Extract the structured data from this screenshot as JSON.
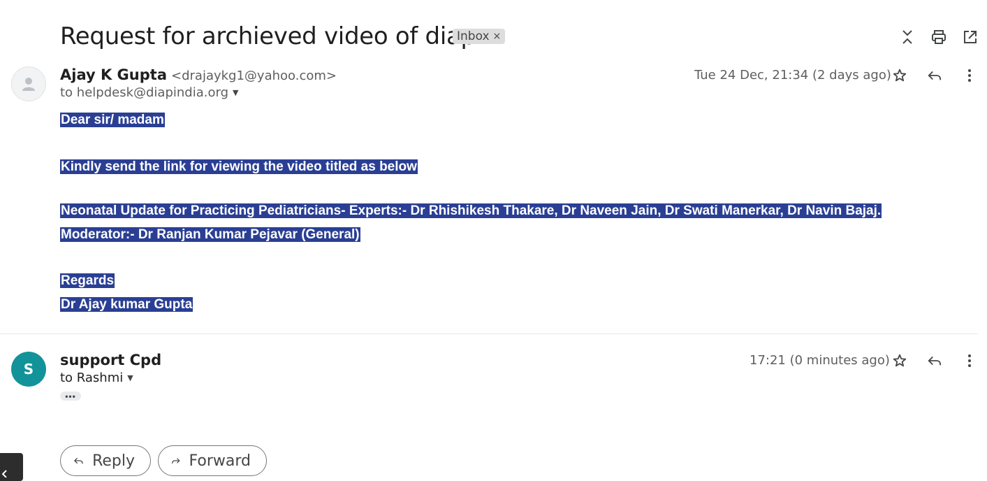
{
  "thread": {
    "subject": "Request for archieved video of diap",
    "label": "Inbox",
    "label_remove": "×",
    "actions": [
      "collapse-all-icon",
      "print-icon",
      "open-in-new-window-icon"
    ]
  },
  "messages": [
    {
      "sender_name": "Ajay K Gupta",
      "sender_email": "<drajaykg1@yahoo.com>",
      "to": "to helpdesk@diapindia.org",
      "date": "Tue 24 Dec, 21:34 (2 days ago)",
      "body": [
        "Dear sir/ madam",
        "Kindly send the link for viewing the video titled as below",
        "Neonatal Update for Practicing Pediatricians- Experts:- Dr Rhishikesh Thakare, Dr Naveen Jain, Dr Swati Manerkar, Dr Navin Bajaj.",
        "Moderator:- Dr Ranjan Kumar Pejavar (General)",
        "Regards",
        "Dr Ajay kumar Gupta"
      ]
    },
    {
      "avatar_letter": "S",
      "sender_name": "support Cpd",
      "to": "to Rashmi",
      "date": "17:21 (0 minutes ago)",
      "trimmed": "•••"
    }
  ],
  "buttons": {
    "reply": "Reply",
    "forward": "Forward"
  },
  "colors": {
    "highlight": "#2a3f94",
    "avatar_teal": "#12939a",
    "chip_bg": "#dddddd"
  }
}
